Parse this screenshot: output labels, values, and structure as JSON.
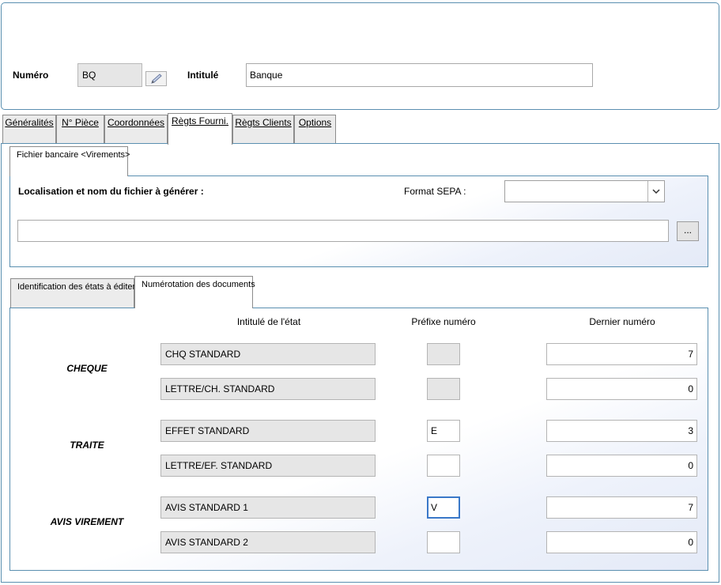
{
  "header": {
    "numero_label": "Numéro",
    "numero_value": "BQ",
    "intitule_label": "Intitulé",
    "intitule_value": "Banque",
    "edit_icon": "pencil-icon"
  },
  "tabs": [
    {
      "label": "Généralités",
      "active": false
    },
    {
      "label": "N° Pièce",
      "active": false
    },
    {
      "label": "Coordonnées",
      "active": false
    },
    {
      "label": "Règts Fourni.",
      "active": true
    },
    {
      "label": "Règts Clients",
      "active": false
    },
    {
      "label": "Options",
      "active": false
    }
  ],
  "fichier": {
    "tab_label": "Fichier bancaire <Virements>",
    "location_label": "Localisation et nom du fichier à générer :",
    "format_label": "Format SEPA :",
    "format_value": "",
    "path_value": "",
    "browse_label": "..."
  },
  "subtabs": [
    {
      "label": "Identification des états à éditer",
      "active": false
    },
    {
      "label": "Numérotation des documents",
      "active": true
    }
  ],
  "numerotation": {
    "col_intitule": "Intitulé de l'état",
    "col_prefixe": "Préfixe numéro",
    "col_dernier": "Dernier numéro",
    "groups": [
      {
        "label": "CHEQUE",
        "rows": [
          {
            "etat": "CHQ STANDARD",
            "prefixe": "",
            "prefixe_disabled": true,
            "dernier": "7"
          },
          {
            "etat": "LETTRE/CH. STANDARD",
            "prefixe": "",
            "prefixe_disabled": true,
            "dernier": "0"
          }
        ]
      },
      {
        "label": "TRAITE",
        "rows": [
          {
            "etat": "EFFET STANDARD",
            "prefixe": "E",
            "prefixe_disabled": false,
            "dernier": "3"
          },
          {
            "etat": "LETTRE/EF. STANDARD",
            "prefixe": "",
            "prefixe_disabled": false,
            "dernier": "0"
          }
        ]
      },
      {
        "label": "AVIS VIREMENT",
        "rows": [
          {
            "etat": "AVIS STANDARD 1",
            "prefixe": "V",
            "prefixe_disabled": false,
            "dernier": "7"
          },
          {
            "etat": "AVIS STANDARD 2",
            "prefixe": "",
            "prefixe_disabled": false,
            "dernier": "0"
          }
        ]
      }
    ]
  },
  "colors": {
    "panel_border": "#5a8fb0",
    "focus_border": "#3a78c8",
    "readonly_bg": "#e6e6e6"
  }
}
